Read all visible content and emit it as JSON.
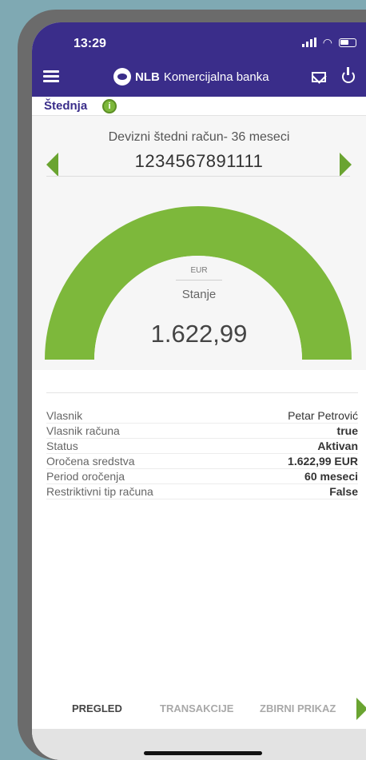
{
  "status_bar": {
    "time": "13:29"
  },
  "header": {
    "brand_bold": "NLB",
    "brand_rest": "Komercijalna banka"
  },
  "section": {
    "title": "Štednja",
    "info_symbol": "i"
  },
  "account": {
    "name": "Devizni štedni račun- 36 meseci",
    "number": "1234567891111"
  },
  "gauge": {
    "currency": "EUR",
    "label": "Stanje",
    "amount": "1.622,99",
    "fill_fraction": 1.0,
    "color": "#7db83b"
  },
  "details": [
    {
      "label": "Vlasnik",
      "value": "Petar Petrović",
      "bold": false
    },
    {
      "label": "Vlasnik računa",
      "value": "true",
      "bold": true
    },
    {
      "label": "Status",
      "value": "Aktivan",
      "bold": true
    },
    {
      "label": "Oročena sredstva",
      "value": "1.622,99 EUR",
      "bold": true
    },
    {
      "label": "Period oročenja",
      "value": "60 meseci",
      "bold": true
    },
    {
      "label": "Restriktivni tip računa",
      "value": "False",
      "bold": true
    }
  ],
  "tabs": [
    {
      "label": "PREGLED",
      "active": true
    },
    {
      "label": "TRANSAKCIJE",
      "active": false
    },
    {
      "label": "ZBIRNI PRIKAZ",
      "active": false
    }
  ],
  "icons": {
    "menu": "menu-icon",
    "logo": "nlb-logo-icon",
    "mail": "mail-icon",
    "power": "power-icon",
    "info": "info-icon",
    "prev": "arrow-left-icon",
    "next": "arrow-right-icon"
  },
  "colors": {
    "header": "#3a2d8a",
    "accent": "#7db83b"
  }
}
